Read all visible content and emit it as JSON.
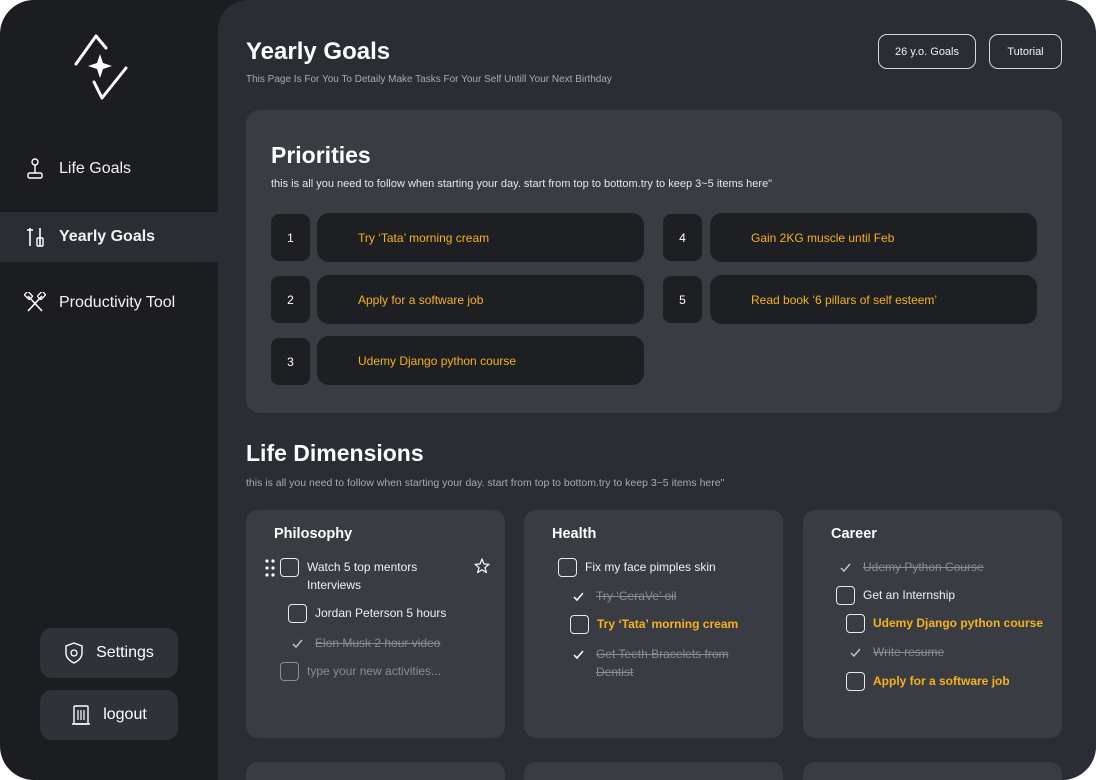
{
  "nav": {
    "items": [
      {
        "label": "Life Goals",
        "icon": "joystick-icon"
      },
      {
        "label": "Yearly Goals",
        "icon": "tools-icon"
      },
      {
        "label": "Productivity Tool",
        "icon": "crossed-hammers-icon"
      }
    ],
    "settings_label": "Settings",
    "logout_label": "logout"
  },
  "header": {
    "title": "Yearly Goals",
    "subtitle": "This Page Is For You To Detaily Make Tasks For Your Self Untill Your Next Birthday",
    "goals_button": "26 y.o. Goals",
    "tutorial_button": "Tutorial"
  },
  "priorities": {
    "title": "Priorities",
    "subtitle": "this is all you need to follow when starting your day. start from top to bottom.try to keep 3~5 items here\"",
    "items": [
      {
        "num": "1",
        "text": "Try ‘Tata’ morning cream"
      },
      {
        "num": "2",
        "text": "Apply for a software job"
      },
      {
        "num": "3",
        "text": "Udemy Django python course"
      },
      {
        "num": "4",
        "text": "Gain 2KG muscle until Feb"
      },
      {
        "num": "5",
        "text": "Read book ‘6 pillars of self esteem’"
      }
    ]
  },
  "dimensions": {
    "title": "Life Dimensions",
    "subtitle": "this is all you need to follow when starting your day. start from top to bottom.try to keep 3~5 items here\"",
    "cards": [
      {
        "title": "Philosophy",
        "tasks": [
          {
            "text": "Watch 5 top mentors Interviews"
          },
          {
            "text": "Jordan Peterson 5 hours"
          },
          {
            "text": "Elon Musk 2 hour video"
          },
          {
            "text": "type your new activities..."
          }
        ]
      },
      {
        "title": "Health",
        "tasks": [
          {
            "text": "Fix my face pimples skin"
          },
          {
            "text": "Try ‘CeraVe’ oil"
          },
          {
            "text": "Try ‘Tata’ morning cream"
          },
          {
            "text": "Get Teeth Bracelets from Dentist"
          }
        ]
      },
      {
        "title": "Career",
        "tasks": [
          {
            "text": "Udemy Python Course"
          },
          {
            "text": "Get an Internship"
          },
          {
            "text": "Udemy Django python course"
          },
          {
            "text": "Write resume"
          },
          {
            "text": "Apply for a software job"
          }
        ]
      }
    ]
  },
  "colors": {
    "accent": "#f6b21b",
    "sidebar_bg": "#1b1d21",
    "main_bg": "#2a2d33",
    "card_bg": "#393c43"
  }
}
